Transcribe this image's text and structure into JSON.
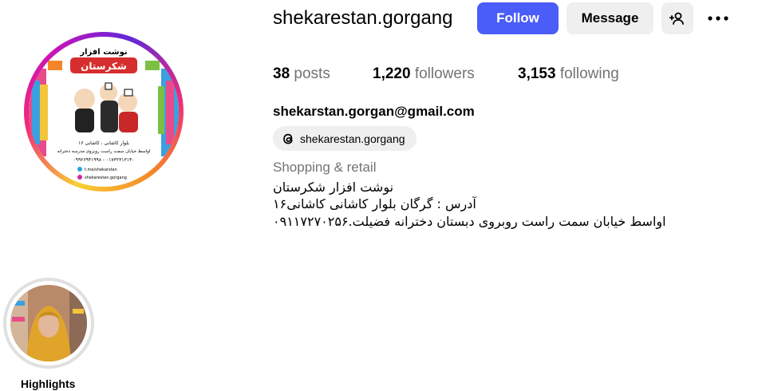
{
  "profile": {
    "username": "shekarestan.gorgang",
    "follow_label": "Follow",
    "message_label": "Message",
    "add_user_icon": "add-user-icon",
    "more_icon": "more-options-icon"
  },
  "avatar": {
    "title_text": "نوشت افزار",
    "brand_text": "شکرستان",
    "address_line1": "بلوار کاشانی ، کاشانی ۱۶",
    "address_line2": "اواسط خیابان سمت راست روبروی مدرسه دخترانه",
    "phones": "۰۹۹۲۶۹۴۱۹۹۸ - ۰۱۷۳۲۳۱۳۱۴۰",
    "telegram": "t.me/shekarstan",
    "instagram": "shekarestan.gorgang"
  },
  "stats": [
    {
      "value": "38",
      "label": "posts"
    },
    {
      "value": "1,220",
      "label": "followers"
    },
    {
      "value": "3,153",
      "label": "following"
    }
  ],
  "email": "shekarstan.gorgan@gmail.com",
  "threads": {
    "handle": "shekarestan.gorgang",
    "icon": "threads-icon"
  },
  "category": "Shopping & retail",
  "bio": [
    "نوشت افزار شکرستان",
    "آدرس : گرگان بلوار کاشانی کاشانی۱۶",
    "اواسط خیابان سمت راست روبروی دبستان دخترانه فضیلت.۰۹۱۱۷۲۷۰۲۵۶"
  ],
  "highlights": [
    {
      "label": "Highlights"
    }
  ],
  "colors": {
    "follow_bg": "#4a5df9",
    "secondary_bg": "#efefef",
    "muted_text": "#737373"
  }
}
